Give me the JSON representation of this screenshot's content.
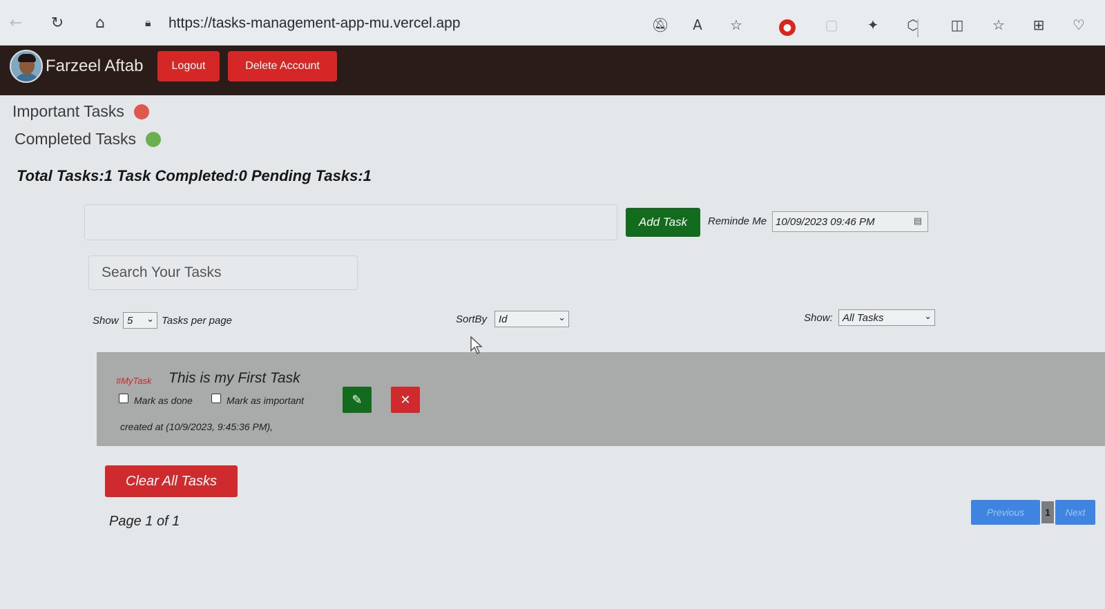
{
  "browser": {
    "url": "https://tasks-management-app-mu.vercel.app",
    "icons": [
      "back-icon",
      "refresh-icon",
      "home-icon",
      "lock-icon",
      "mute-icon",
      "read-aloud-icon",
      "favorite-star-icon",
      "extension-red-icon",
      "tab-icon",
      "sparkle-icon",
      "extensions-icon",
      "split-screen-icon",
      "favorites-icon",
      "collections-icon",
      "heart-health-icon"
    ],
    "read_aloud_label": "A"
  },
  "header": {
    "username": "Farzeel Aftab",
    "logout_label": "Logout",
    "delete_label": "Delete Account",
    "button_color": "#d62727"
  },
  "legend": {
    "important_label": "Important Tasks",
    "important_color": "#e0574c",
    "completed_label": "Completed Tasks",
    "completed_color": "#6ab04c"
  },
  "stats": {
    "text": "Total Tasks:1 Task Completed:0 Pending Tasks:1"
  },
  "new_task": {
    "input_value": "",
    "add_label": "Add Task",
    "remind_label": "Reminde Me",
    "remind_value": "10/09/2023 09:46 PM"
  },
  "search": {
    "placeholder": "Search Your Tasks"
  },
  "controls": {
    "show_label": "Show",
    "per_page_value": "5",
    "per_page_suffix": "Tasks per page",
    "sort_label": "SortBy",
    "sort_value": "Id",
    "filter_label": "Show:",
    "filter_value": "All Tasks"
  },
  "tasks": [
    {
      "tag": "#MyTask",
      "title": "This is my First Task",
      "done_label": "Mark as done",
      "important_label": "Mark as important",
      "created": "created at (10/9/2023, 9:45:36 PM),",
      "edit_color": "#136b1e",
      "delete_color": "#cf2a2e"
    }
  ],
  "footer": {
    "clear_label": "Clear All Tasks",
    "page_info": "Page 1 of 1",
    "previous_label": "Previous",
    "current_page": "1",
    "next_label": "Next"
  }
}
